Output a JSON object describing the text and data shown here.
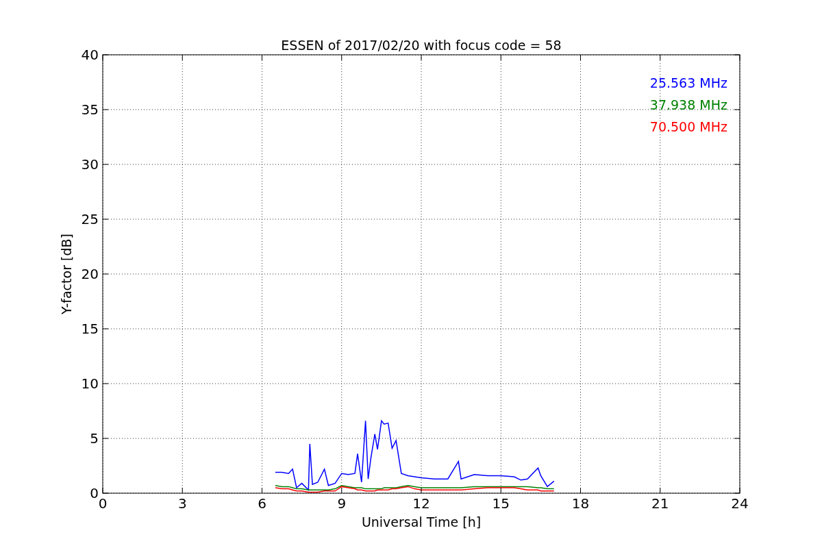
{
  "chart_data": {
    "type": "line",
    "title": "ESSEN of 2017/02/20 with focus code = 58",
    "xlabel": "Universal Time [h]",
    "ylabel": "Y-factor [dB]",
    "xlim": [
      0,
      24
    ],
    "ylim": [
      0,
      40
    ],
    "xticks": [
      0,
      3,
      6,
      9,
      12,
      15,
      18,
      21,
      24
    ],
    "yticks": [
      0,
      5,
      10,
      15,
      20,
      25,
      30,
      35,
      40
    ],
    "grid": true,
    "x": [
      6.5,
      6.75,
      7.0,
      7.15,
      7.3,
      7.5,
      7.75,
      7.8,
      7.9,
      8.1,
      8.35,
      8.5,
      8.75,
      9.0,
      9.25,
      9.5,
      9.6,
      9.75,
      9.9,
      10.0,
      10.1,
      10.25,
      10.35,
      10.5,
      10.6,
      10.75,
      10.9,
      11.05,
      11.25,
      11.5,
      11.75,
      12.0,
      12.5,
      13.0,
      13.4,
      13.5,
      14.0,
      14.5,
      15.0,
      15.5,
      15.75,
      16.0,
      16.4,
      16.5,
      16.75,
      17.0
    ],
    "series": [
      {
        "name": "25.563 MHz",
        "color": "#0000ff",
        "values": [
          1.9,
          1.9,
          1.8,
          2.2,
          0.5,
          0.9,
          0.3,
          4.5,
          0.8,
          1.0,
          2.2,
          0.7,
          0.9,
          1.8,
          1.7,
          1.8,
          3.6,
          1.0,
          6.6,
          1.3,
          3.2,
          5.4,
          4.0,
          6.6,
          6.3,
          6.4,
          4.1,
          4.8,
          1.8,
          1.6,
          1.5,
          1.4,
          1.3,
          1.3,
          2.9,
          1.3,
          1.7,
          1.6,
          1.6,
          1.5,
          1.2,
          1.3,
          2.3,
          1.6,
          0.6,
          1.1
        ]
      },
      {
        "name": "37.938 MHz",
        "color": "#008000",
        "values": [
          0.7,
          0.6,
          0.6,
          0.5,
          0.4,
          0.4,
          0.3,
          0.3,
          0.3,
          0.3,
          0.3,
          0.3,
          0.4,
          0.7,
          0.6,
          0.5,
          0.5,
          0.5,
          0.4,
          0.4,
          0.4,
          0.4,
          0.4,
          0.4,
          0.5,
          0.5,
          0.5,
          0.5,
          0.6,
          0.7,
          0.6,
          0.5,
          0.5,
          0.5,
          0.5,
          0.5,
          0.6,
          0.6,
          0.6,
          0.6,
          0.6,
          0.6,
          0.5,
          0.5,
          0.4,
          0.4
        ]
      },
      {
        "name": "70.500 MHz",
        "color": "#ff0000",
        "values": [
          0.5,
          0.4,
          0.4,
          0.3,
          0.2,
          0.2,
          0.1,
          0.1,
          0.1,
          0.1,
          0.2,
          0.2,
          0.2,
          0.6,
          0.5,
          0.4,
          0.3,
          0.3,
          0.2,
          0.2,
          0.2,
          0.2,
          0.3,
          0.3,
          0.3,
          0.3,
          0.4,
          0.4,
          0.5,
          0.6,
          0.4,
          0.3,
          0.3,
          0.3,
          0.3,
          0.3,
          0.4,
          0.5,
          0.5,
          0.5,
          0.4,
          0.3,
          0.3,
          0.2,
          0.2,
          0.2
        ]
      }
    ]
  }
}
